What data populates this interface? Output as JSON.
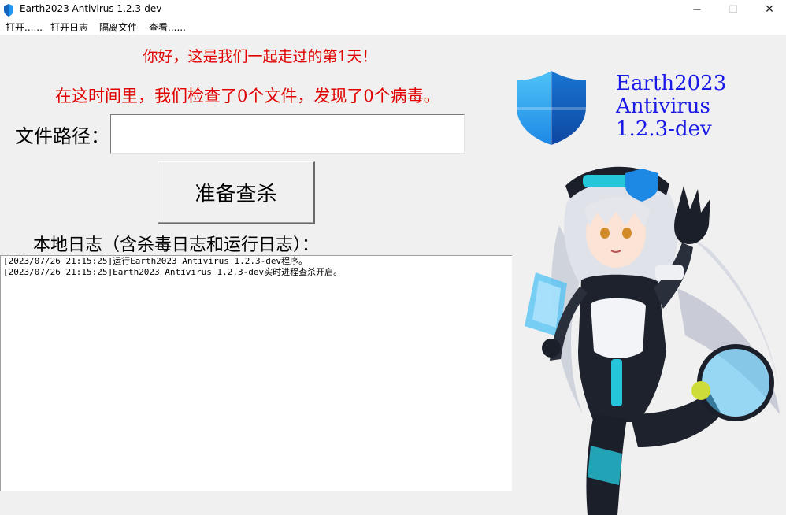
{
  "window": {
    "title": "Earth2023 Antivirus 1.2.3-dev",
    "minimize_glyph": "—",
    "maximize_glyph": "☐",
    "close_glyph": "✕"
  },
  "menu": {
    "items": [
      "打开......",
      "打开日志",
      "隔离文件",
      "查看......"
    ]
  },
  "main": {
    "greeting": "你好，这是我们一起走过的第1天！",
    "stats": "在这时间里，我们检查了0个文件，发现了0个病毒。",
    "path_label": "文件路径：",
    "path_value": "",
    "scan_button": "准备查杀",
    "log_label": "本地日志（含杀毒日志和运行日志）：",
    "log_lines": [
      "[2023/07/26 21:15:25]运行Earth2023 Antivirus 1.2.3-dev程序。",
      "[2023/07/26 21:15:25]Earth2023 Antivirus 1.2.3-dev实时进程查杀开启。"
    ]
  },
  "brand": {
    "product_lines": [
      "Earth2023",
      "Antivirus",
      "1.2.3-dev"
    ],
    "logo_icon": "shield-icon",
    "mascot_icon": "anime-mascot-illustration",
    "accent_color": "#1a1ae6",
    "warning_color": "#e00000",
    "shield_color": "#1e88e5"
  }
}
